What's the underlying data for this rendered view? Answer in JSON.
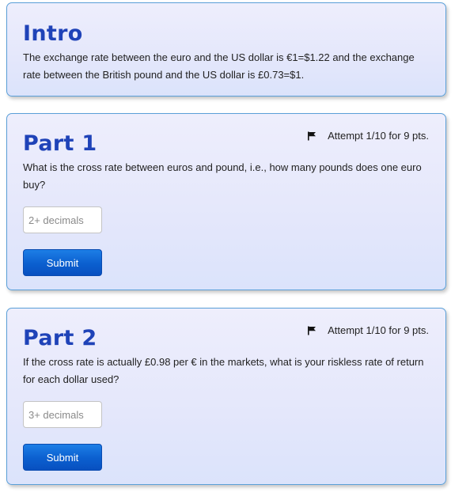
{
  "intro": {
    "title": "Intro",
    "text": "The exchange rate between the euro and the US dollar is €1=$1.22 and the exchange rate between the British pound and the US dollar is £0.73=$1."
  },
  "parts": [
    {
      "title": "Part 1",
      "attempt": "Attempt 1/10 for 9 pts.",
      "question": "What is the cross rate between euros and pound, i.e., how many pounds does one euro buy?",
      "input_value": "",
      "input_placeholder": "2+ decimals",
      "submit_label": "Submit"
    },
    {
      "title": "Part 2",
      "attempt": "Attempt 1/10 for 9 pts.",
      "question": "If the cross rate is actually £0.98 per € in the markets, what is your riskless rate of return for each dollar used?",
      "input_value": "",
      "input_placeholder": "3+ decimals",
      "submit_label": "Submit"
    }
  ],
  "icons": {
    "attempt_flag": "flag-icon"
  },
  "colors": {
    "title": "#1f43b8",
    "card_border": "#5a9fd8",
    "button": "#0b5fcf"
  }
}
